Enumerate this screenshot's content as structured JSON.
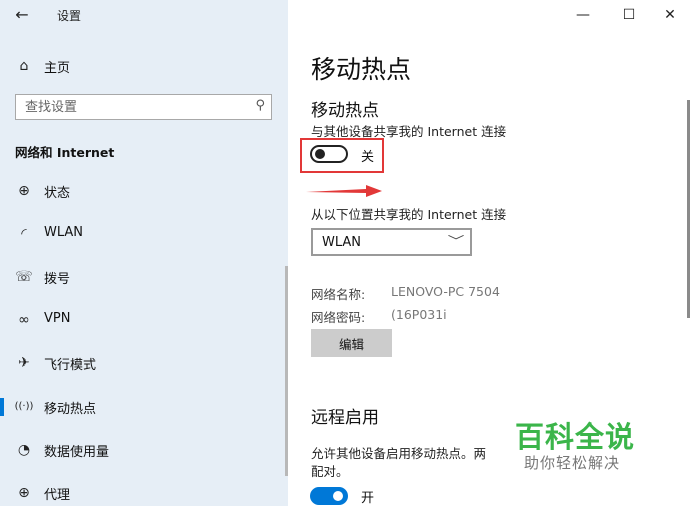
{
  "window": {
    "title": "设置",
    "back_icon": "←",
    "minimize_icon": "—",
    "maximize_icon": "☐",
    "close_icon": "✕"
  },
  "sidebar": {
    "home": {
      "icon": "⌂",
      "label": "主页"
    },
    "search": {
      "placeholder": "查找设置",
      "icon": "⚲"
    },
    "section_header": "网络和 Internet",
    "items": [
      {
        "icon": "⊕",
        "label": "状态"
      },
      {
        "icon": "◜",
        "label": "WLAN"
      },
      {
        "icon": "☏",
        "label": "拨号"
      },
      {
        "icon": "∞",
        "label": "VPN"
      },
      {
        "icon": "✈",
        "label": "飞行模式"
      },
      {
        "icon": "((·))",
        "label": "移动热点",
        "active": true
      },
      {
        "icon": "◔",
        "label": "数据使用量"
      },
      {
        "icon": "⊕",
        "label": "代理"
      }
    ],
    "active_color": "#0078d7"
  },
  "main": {
    "page_title": "移动热点",
    "hotspot": {
      "heading": "移动热点",
      "share_desc": "与其他设备共享我的 Internet 连接",
      "toggle_state": "关",
      "share_from_label": "从以下位置共享我的 Internet 连接",
      "share_from_value": "WLAN",
      "chevron_icon": "﹀",
      "network_name_key": "网络名称:",
      "network_name_value": "LENOVO-PC 7504",
      "network_password_key": "网络密码:",
      "network_password_value": "(16P031i",
      "edit_label": "编辑"
    },
    "remote": {
      "heading": "远程启用",
      "desc_line1": "允许其他设备启用移动热点。两",
      "desc_line2": "配对。",
      "toggle_state": "开"
    },
    "watermark": {
      "title": "百科全说",
      "subtitle": "助你轻松解决"
    }
  }
}
